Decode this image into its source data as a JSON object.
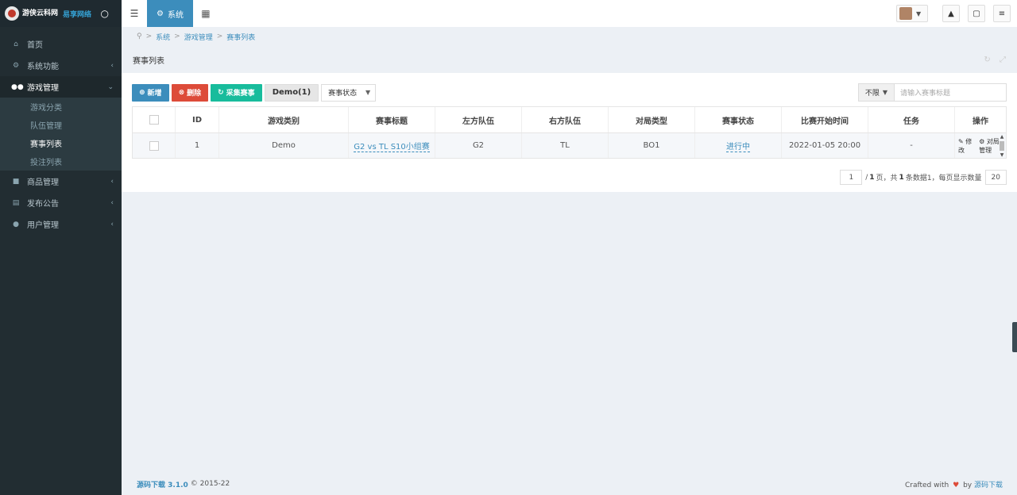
{
  "brand": {
    "logo_text": "游侠云科网",
    "logo_sub": "易享网络",
    "drop_icon": "droplet-icon"
  },
  "sidebar": {
    "items": [
      {
        "label": "首页",
        "icon": "home-icon"
      },
      {
        "label": "系统功能",
        "icon": "gear-icon"
      },
      {
        "label": "游戏管理",
        "icon": "gamepad-icon"
      },
      {
        "label": "商品管理",
        "icon": "shop-icon"
      },
      {
        "label": "发布公告",
        "icon": "notice-icon"
      },
      {
        "label": "用户管理",
        "icon": "users-icon"
      }
    ],
    "submenu": [
      "游戏分类",
      "队伍管理",
      "赛事列表",
      "投注列表"
    ]
  },
  "topbar": {
    "tab_label": "系统"
  },
  "breadcrumb": [
    "系统",
    "游戏管理",
    "赛事列表"
  ],
  "page_title": "赛事列表",
  "toolbar": {
    "add": "新增",
    "delete": "删除",
    "collect": "采集赛事",
    "demo": "Demo(1)",
    "status_select": "赛事状态",
    "search_scope": "不限",
    "search_placeholder": "请输入赛事标题"
  },
  "table": {
    "headers": [
      "ID",
      "游戏类别",
      "赛事标题",
      "左方队伍",
      "右方队伍",
      "对局类型",
      "赛事状态",
      "比赛开始时间",
      "任务",
      "操作"
    ],
    "rows": [
      {
        "id": "1",
        "game": "Demo",
        "title": "G2 vs TL S10小组赛",
        "left": "G2",
        "right": "TL",
        "type": "BO1",
        "status": "进行中",
        "start": "2022-01-05 20:00",
        "task": "-",
        "edit": "修改",
        "manage": "对局管理"
      }
    ]
  },
  "pagination": {
    "page": "1",
    "text_pre": "/",
    "total_pages": "1",
    "text_mid": "页，共",
    "total_count": "1",
    "text_post": "条数据1，每页显示数量",
    "page_size": "20"
  },
  "footer": {
    "brand": "源码下载",
    "version": "3.1.0",
    "copyright": "© 2015-22",
    "crafted": "Crafted with",
    "by": "by",
    "by_link": "源码下载"
  },
  "colors": {
    "sidebar_bg": "#222d32",
    "accent": "#3c8dbc",
    "danger": "#dd4b39",
    "success": "#18bc9c"
  }
}
